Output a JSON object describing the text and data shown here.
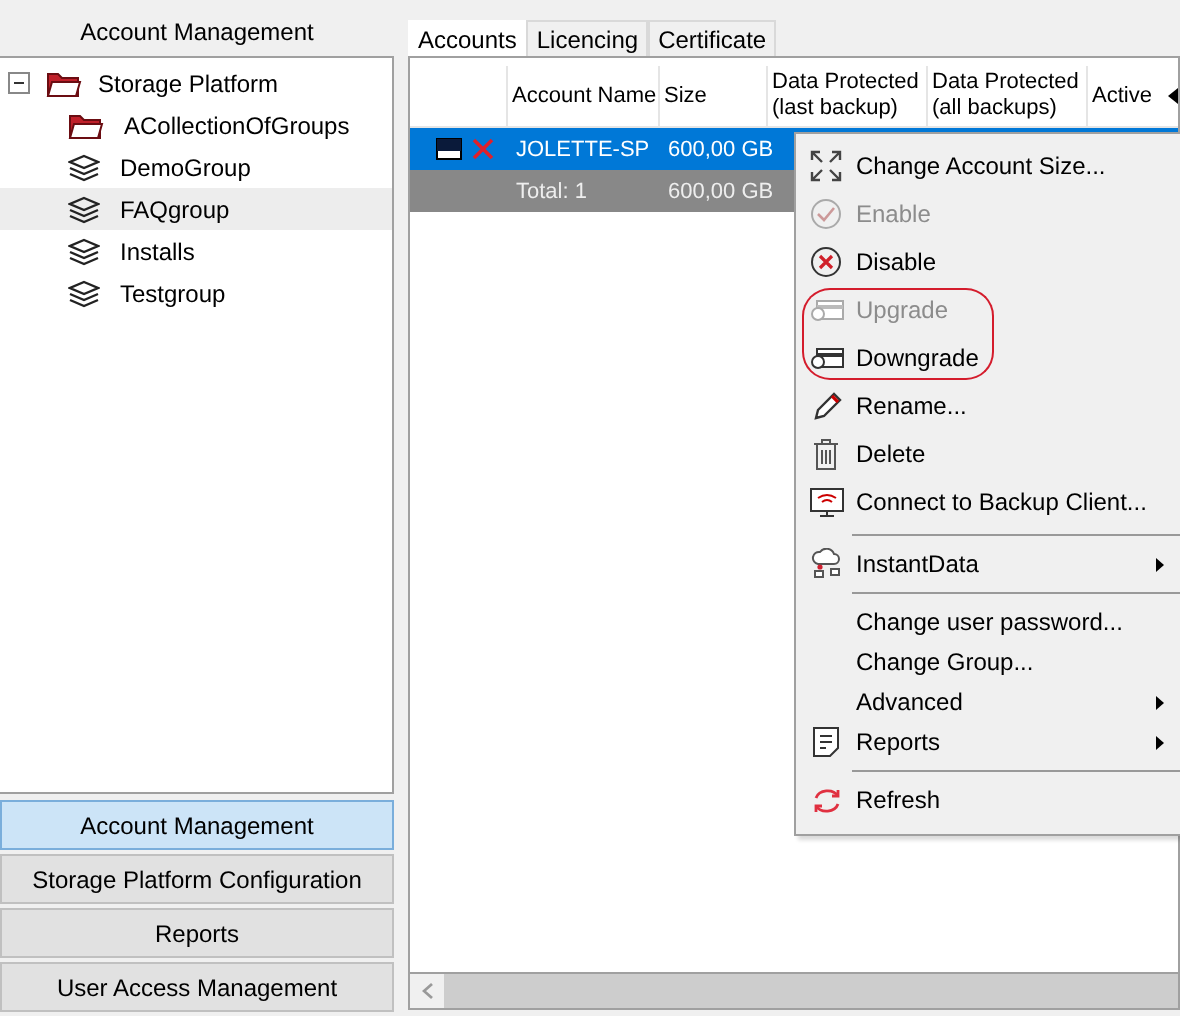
{
  "sidebar": {
    "title": "Account Management",
    "tree": [
      {
        "label": "Storage Platform",
        "kind": "folder",
        "expanded": true,
        "selected": false,
        "children": [
          {
            "label": "ACollectionOfGroups",
            "kind": "folder",
            "selected": false
          },
          {
            "label": "DemoGroup",
            "kind": "group",
            "selected": false
          },
          {
            "label": "FAQgroup",
            "kind": "group",
            "selected": true
          },
          {
            "label": "Installs",
            "kind": "group",
            "selected": false
          },
          {
            "label": "Testgroup",
            "kind": "group",
            "selected": false
          }
        ]
      }
    ],
    "nav": [
      {
        "label": "Account Management",
        "selected": true
      },
      {
        "label": "Storage Platform Configuration",
        "selected": false
      },
      {
        "label": "Reports",
        "selected": false
      },
      {
        "label": "User Access Management",
        "selected": false
      }
    ]
  },
  "tabs": [
    {
      "label": "Accounts",
      "selected": true
    },
    {
      "label": "Licencing",
      "selected": false
    },
    {
      "label": "Certificate",
      "selected": false
    }
  ],
  "table": {
    "columns": [
      "Account Name",
      "Size",
      "Data Protected (last backup)",
      "Data Protected (all backups)",
      "Active"
    ],
    "rows": [
      {
        "kind": "account",
        "selected": true,
        "cells": [
          "JOLETTE-SP",
          "600,00 GB"
        ]
      },
      {
        "kind": "total",
        "selected": false,
        "cells": [
          "Total: 1",
          "600,00 GB"
        ]
      }
    ]
  },
  "context_menu": [
    {
      "kind": "item",
      "label": "Change Account Size...",
      "disabled": false,
      "submenu": false,
      "highlighted": false
    },
    {
      "kind": "item",
      "label": "Enable",
      "disabled": true,
      "submenu": false,
      "highlighted": false
    },
    {
      "kind": "item",
      "label": "Disable",
      "disabled": false,
      "submenu": false,
      "highlighted": false
    },
    {
      "kind": "item",
      "label": "Upgrade",
      "disabled": true,
      "submenu": false,
      "highlighted": true
    },
    {
      "kind": "item",
      "label": "Downgrade",
      "disabled": false,
      "submenu": false,
      "highlighted": true
    },
    {
      "kind": "item",
      "label": "Rename...",
      "disabled": false,
      "submenu": false,
      "highlighted": false
    },
    {
      "kind": "item",
      "label": "Delete",
      "disabled": false,
      "submenu": false,
      "highlighted": false
    },
    {
      "kind": "item",
      "label": "Connect to Backup Client...",
      "disabled": false,
      "submenu": false,
      "highlighted": false
    },
    {
      "kind": "separator"
    },
    {
      "kind": "item",
      "label": "InstantData",
      "disabled": false,
      "submenu": true,
      "highlighted": false
    },
    {
      "kind": "separator"
    },
    {
      "kind": "item",
      "label": "Change user password...",
      "disabled": false,
      "submenu": false,
      "highlighted": false
    },
    {
      "kind": "item",
      "label": "Change Group...",
      "disabled": false,
      "submenu": false,
      "highlighted": false
    },
    {
      "kind": "item",
      "label": "Advanced",
      "disabled": false,
      "submenu": true,
      "highlighted": false
    },
    {
      "kind": "item",
      "label": "Reports",
      "disabled": false,
      "submenu": true,
      "highlighted": false
    },
    {
      "kind": "separator"
    },
    {
      "kind": "item",
      "label": "Refresh",
      "disabled": false,
      "submenu": false,
      "highlighted": false
    }
  ]
}
